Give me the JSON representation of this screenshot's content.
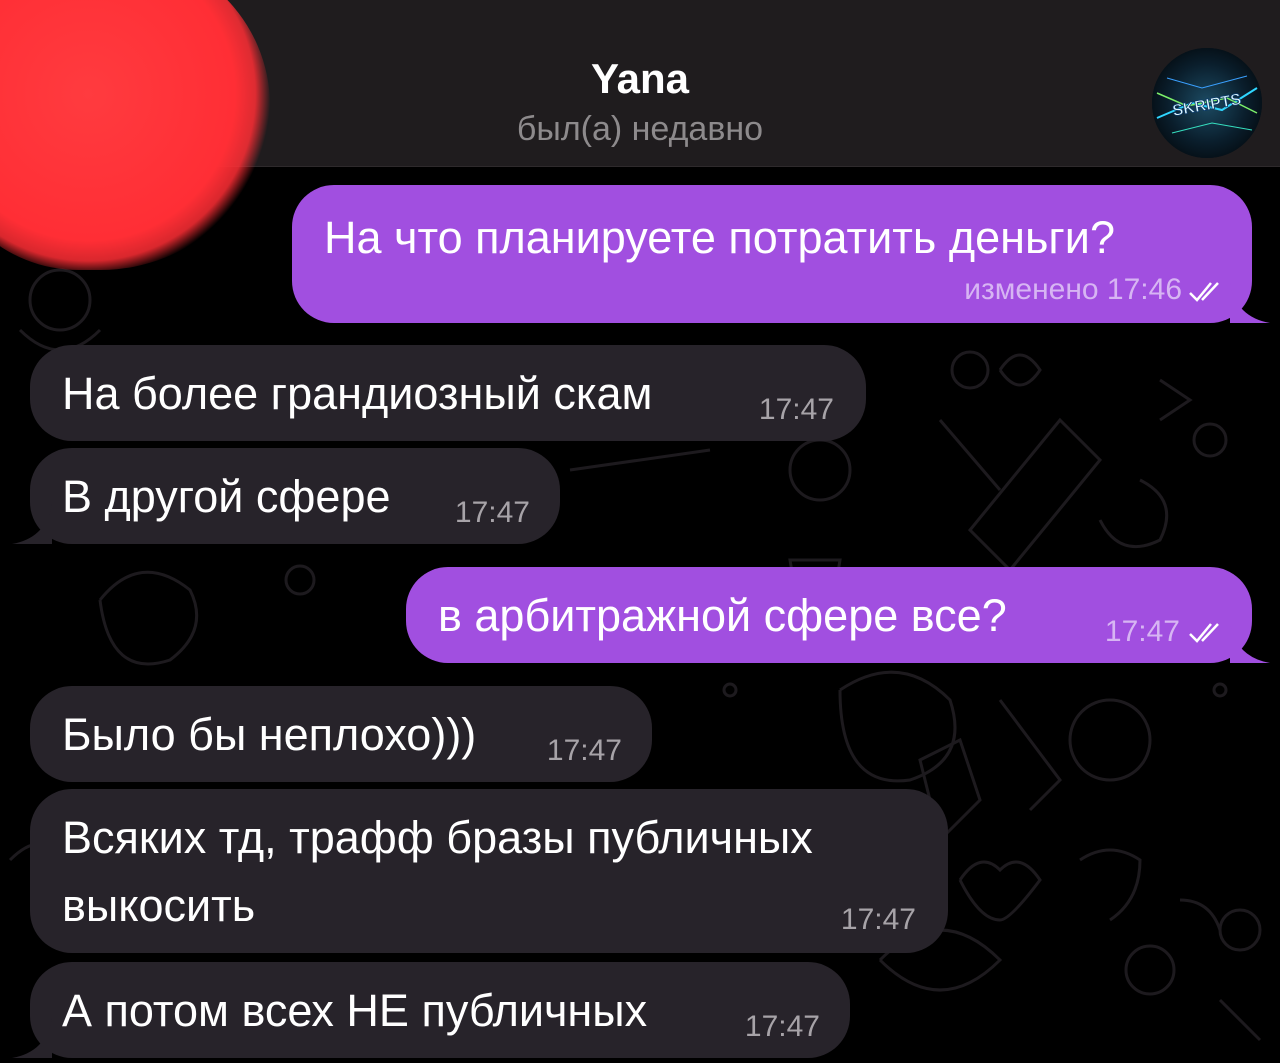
{
  "header": {
    "contact_name": "Yana",
    "status": "был(а) недавно",
    "avatar_text": "SKRIPTS"
  },
  "messages": [
    {
      "direction": "out",
      "text": "На что планируете потратить деньги?",
      "meta": "изменено 17:46",
      "read": true
    },
    {
      "direction": "in",
      "text": "На более грандиозный скам",
      "meta": "17:47"
    },
    {
      "direction": "in",
      "text": "В другой сфере",
      "meta": "17:47"
    },
    {
      "direction": "out",
      "text": "в арбитражной сфере все?",
      "meta": "17:47",
      "read": true
    },
    {
      "direction": "in",
      "text": "Было бы неплохо)))",
      "meta": "17:47"
    },
    {
      "direction": "in",
      "text_line1": "Всяких тд, трафф бразы публичных",
      "text_line2": "выкосить",
      "meta": "17:47"
    },
    {
      "direction": "in",
      "text": "А потом всех НЕ публичных",
      "meta": "17:47"
    }
  ],
  "colors": {
    "outgoing_bubble": "#a14fe0",
    "incoming_bubble": "#27232a",
    "header_bg": "#1f1c1e",
    "redaction": "#ff2e35",
    "background": "#000000"
  },
  "icons": [
    "double-check-icon",
    "avatar-image",
    "redaction-mark"
  ]
}
